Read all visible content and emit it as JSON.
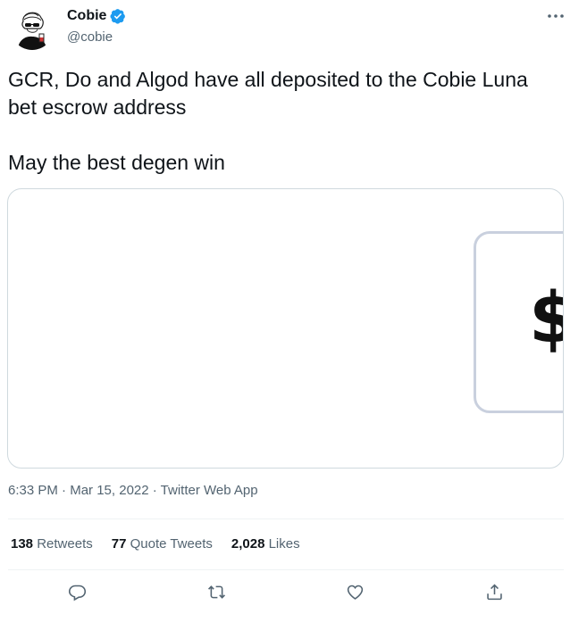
{
  "author": {
    "name": "Cobie",
    "handle": "@cobie",
    "verified_icon": "verified-badge-icon",
    "verified_color": "#1d9bf0"
  },
  "more_label": "···",
  "tweet": {
    "paragraph1": "GCR, Do and Algod have all deposited to the Cobie Luna bet escrow address",
    "paragraph2": "May the best degen win"
  },
  "media": {
    "symbol": "$"
  },
  "meta": {
    "time": "6:33 PM",
    "sep1": " · ",
    "date": "Mar 15, 2022",
    "sep2": " · ",
    "source": "Twitter Web App"
  },
  "stats": {
    "retweets_count": "138",
    "retweets_label": "Retweets",
    "quotes_count": "77",
    "quotes_label": "Quote Tweets",
    "likes_count": "2,028",
    "likes_label": "Likes"
  },
  "actions": {
    "reply_icon": "reply-icon",
    "retweet_icon": "retweet-icon",
    "like_icon": "like-icon",
    "share_icon": "share-icon"
  },
  "colors": {
    "text": "#0f1419",
    "secondary": "#536471",
    "border": "#cfd9de",
    "divider": "#eff3f4"
  }
}
